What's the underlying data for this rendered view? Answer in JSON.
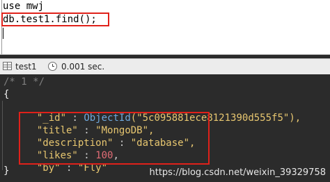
{
  "editor": {
    "line1": "use mwj",
    "line2": "db.test1.find();"
  },
  "status": {
    "collection": "test1",
    "time": "0.001 sec."
  },
  "result": {
    "comment": "/* 1 */",
    "open": "{",
    "id_key": "\"_id\"",
    "id_fn": "ObjectId",
    "id_val": "(\"5c095881ece8121390d555f5\"),",
    "title_key": "\"title\"",
    "title_val": "\"MongoDB\",",
    "desc_key": "\"description\"",
    "desc_val": "\"database\",",
    "likes_key": "\"likes\"",
    "likes_val": "100",
    "by_key": "\"by\"",
    "by_val": "\"Fly\"",
    "close": "}",
    "sep": " : ",
    "comma": ","
  },
  "watermark": "https://blog.csdn.net/weixin_39329758",
  "colors": {
    "highlight": "#e0211a"
  }
}
